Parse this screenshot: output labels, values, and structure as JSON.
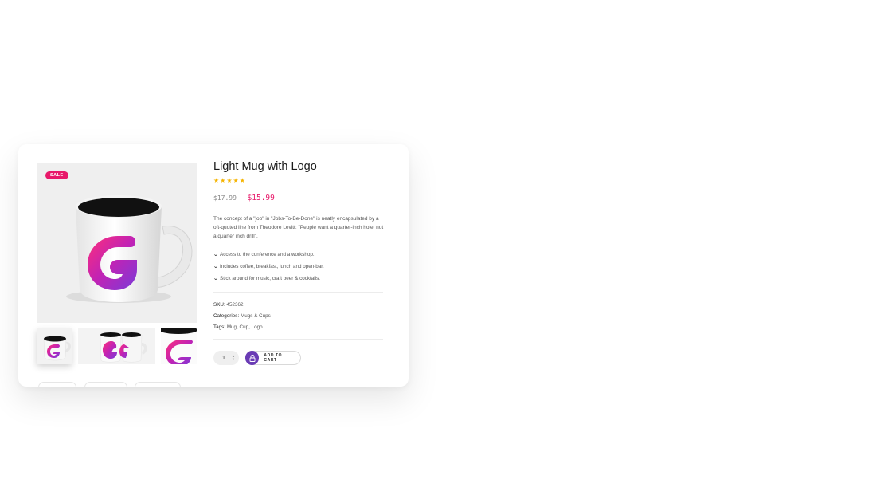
{
  "product": {
    "badge": "SALE",
    "title": "Light Mug with Logo",
    "rating": 5,
    "old_price": "$17.99",
    "new_price": "$15.99",
    "description": "The concept of a \"job\" in \"Jobs-To-Be-Done\" is neatly encapsulated by a oft-quoted line from Theodore Levitt: \"People want a quarter-inch hole, not a quarter inch drill\".",
    "features": [
      "Access to the conference and a workshop.",
      "Includes coffee, breakfast, lunch and open-bar.",
      "Stick around for music, craft beer & cocktails."
    ],
    "meta": {
      "sku_label": "SKU:",
      "sku_value": "452362",
      "categories_label": "Categories:",
      "categories_value": "Mugs & Cups",
      "tags_label": "Tags:",
      "tags_value": "Mug, Cup, Logo"
    },
    "quantity": "1",
    "add_to_cart": "ADD TO CART"
  },
  "colors": {
    "accent": "#e8196a",
    "button": "#6a3bb5",
    "star": "#f5b400"
  },
  "icons": {
    "star": "star-icon",
    "feature": "chevron-down-icon",
    "cart": "lock-icon",
    "qty_up": "caret-up-icon",
    "qty_down": "caret-down-icon"
  }
}
